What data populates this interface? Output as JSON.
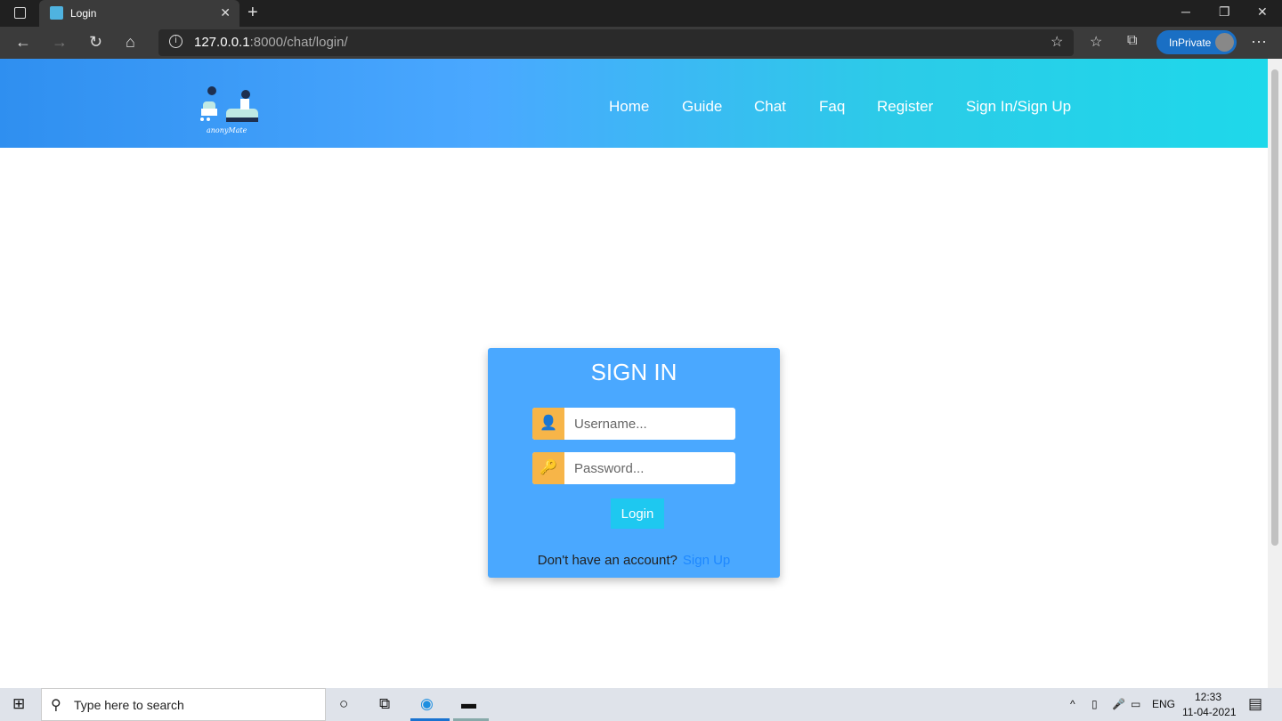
{
  "browser": {
    "tab_title": "Login",
    "url_host": "127.0.0.1",
    "url_rest": ":8000/chat/login/",
    "inprivate_label": "InPrivate"
  },
  "nav": {
    "logo_text": "anonyMate",
    "items": [
      "Home",
      "Guide",
      "Chat",
      "Faq",
      "Register",
      "Sign In/Sign Up"
    ]
  },
  "login": {
    "title": "SIGN IN",
    "username_placeholder": "Username...",
    "password_placeholder": "Password...",
    "button": "Login",
    "footer_text": "Don't have an account?",
    "signup_link": "Sign Up"
  },
  "colors": {
    "card": "#4aa8ff",
    "icon_bg": "#f7b548",
    "button": "#1ec8f0",
    "link": "#1e88ff"
  },
  "taskbar": {
    "search_placeholder": "Type here to search",
    "language": "ENG",
    "time": "12:33",
    "date": "11-04-2021"
  }
}
